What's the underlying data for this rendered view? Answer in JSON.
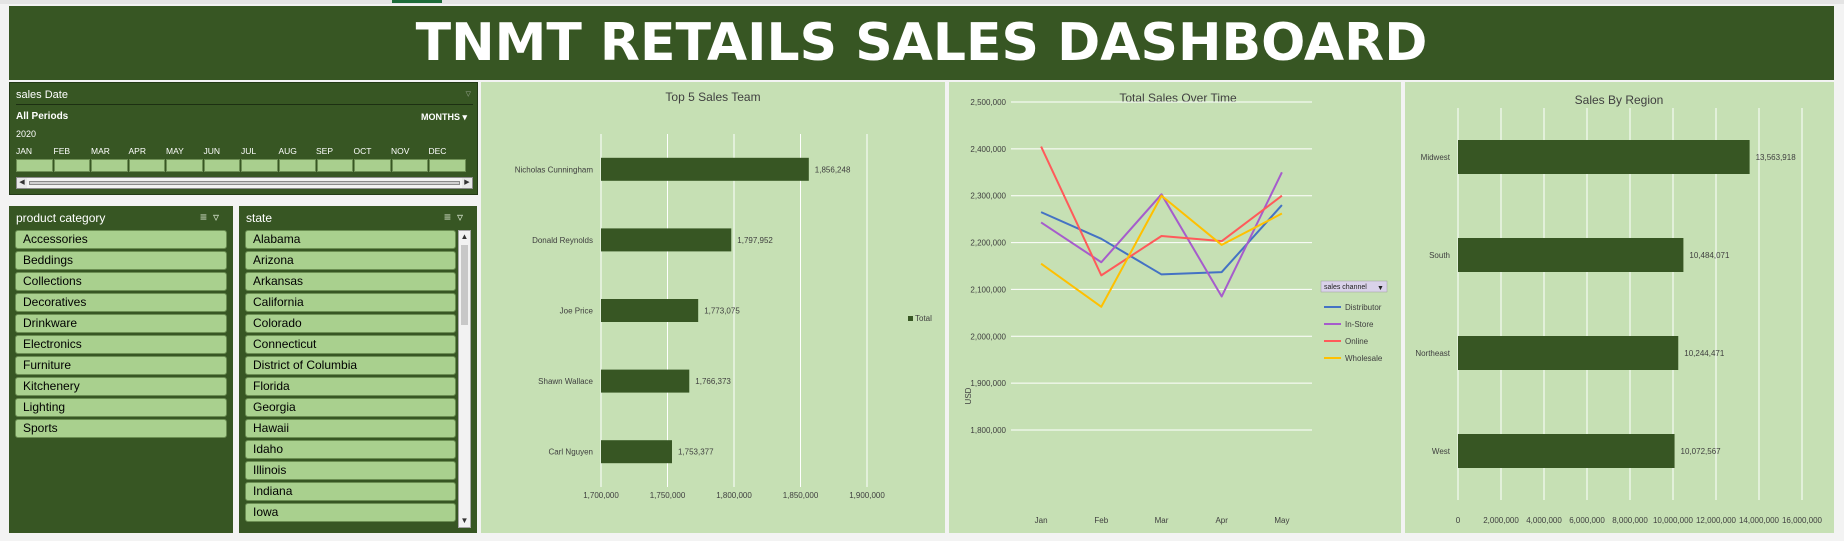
{
  "title": "TNMT RETAILS SALES DASHBOARD",
  "timeline": {
    "header": "sales Date",
    "period": "All Periods",
    "level": "MONTHS ▾",
    "year": "2020",
    "months": [
      "JAN",
      "FEB",
      "MAR",
      "APR",
      "MAY",
      "JUN",
      "JUL",
      "AUG",
      "SEP",
      "OCT",
      "NOV",
      "DEC"
    ]
  },
  "product_slicer": {
    "header": "product category",
    "items": [
      "Accessories",
      "Beddings",
      "Collections",
      "Decoratives",
      "Drinkware",
      "Electronics",
      "Furniture",
      "Kitchenery",
      "Lighting",
      "Sports"
    ]
  },
  "state_slicer": {
    "header": "state",
    "items": [
      "Alabama",
      "Arizona",
      "Arkansas",
      "California",
      "Colorado",
      "Connecticut",
      "District of Columbia",
      "Florida",
      "Georgia",
      "Hawaii",
      "Idaho",
      "Illinois",
      "Indiana",
      "Iowa"
    ]
  },
  "colors": {
    "dark_green": "#375623",
    "panel_green": "#c6e0b4",
    "item_green": "#a9d08e"
  },
  "chart_data": [
    {
      "type": "bar",
      "title": "Top 5 Sales Team",
      "categories": [
        "Nicholas Cunningham",
        "Donald Reynolds",
        "Joe Price",
        "Shawn Wallace",
        "Carl Nguyen"
      ],
      "values": [
        1856248,
        1797952,
        1773075,
        1766373,
        1753377
      ],
      "data_labels": [
        "1,856,248",
        "1,797,952",
        "1,773,075",
        "1,766,373",
        "1,753,377"
      ],
      "xlim": [
        1700000,
        1900000
      ],
      "x_ticks": [
        "1,700,000",
        "1,750,000",
        "1,800,000",
        "1,850,000",
        "1,900,000"
      ],
      "legend": [
        "Total"
      ],
      "legend_position": "right",
      "orientation": "horizontal",
      "grid": true
    },
    {
      "type": "line",
      "title": "Total Sales Over Time",
      "ylabel": "USD",
      "categories": [
        "Jan",
        "Feb",
        "Mar",
        "Apr",
        "May"
      ],
      "ylim": [
        1800000,
        2500000
      ],
      "y_ticks": [
        "1,800,000",
        "1,900,000",
        "2,000,000",
        "2,100,000",
        "2,200,000",
        "2,300,000",
        "2,400,000",
        "2,500,000"
      ],
      "legend_title": "sales channel",
      "legend_position": "right",
      "grid": true,
      "series": [
        {
          "name": "Distributor",
          "color": "#4472c4",
          "values": [
            2265000,
            2208000,
            2132000,
            2137000,
            2280000
          ]
        },
        {
          "name": "In-Store",
          "color": "#a65ccc",
          "values": [
            2243000,
            2158000,
            2303000,
            2085000,
            2350000
          ]
        },
        {
          "name": "Online",
          "color": "#ff5a5a",
          "values": [
            2405000,
            2130000,
            2214000,
            2203000,
            2300000
          ]
        },
        {
          "name": "Wholesale",
          "color": "#ffc000",
          "values": [
            2155000,
            2063000,
            2300000,
            2195000,
            2262000
          ]
        }
      ]
    },
    {
      "type": "bar",
      "title": "Sales By Region",
      "categories": [
        "Midwest",
        "South",
        "Northeast",
        "West"
      ],
      "values": [
        13563918,
        10484071,
        10244471,
        10072567
      ],
      "data_labels": [
        "13,563,918",
        "10,484,071",
        "10,244,471",
        "10,072,567"
      ],
      "xlim": [
        0,
        16000000
      ],
      "x_ticks": [
        "0",
        "2,000,000",
        "4,000,000",
        "6,000,000",
        "8,000,000",
        "10,000,000",
        "12,000,000",
        "14,000,000",
        "16,000,000"
      ],
      "orientation": "horizontal",
      "grid": true
    }
  ]
}
